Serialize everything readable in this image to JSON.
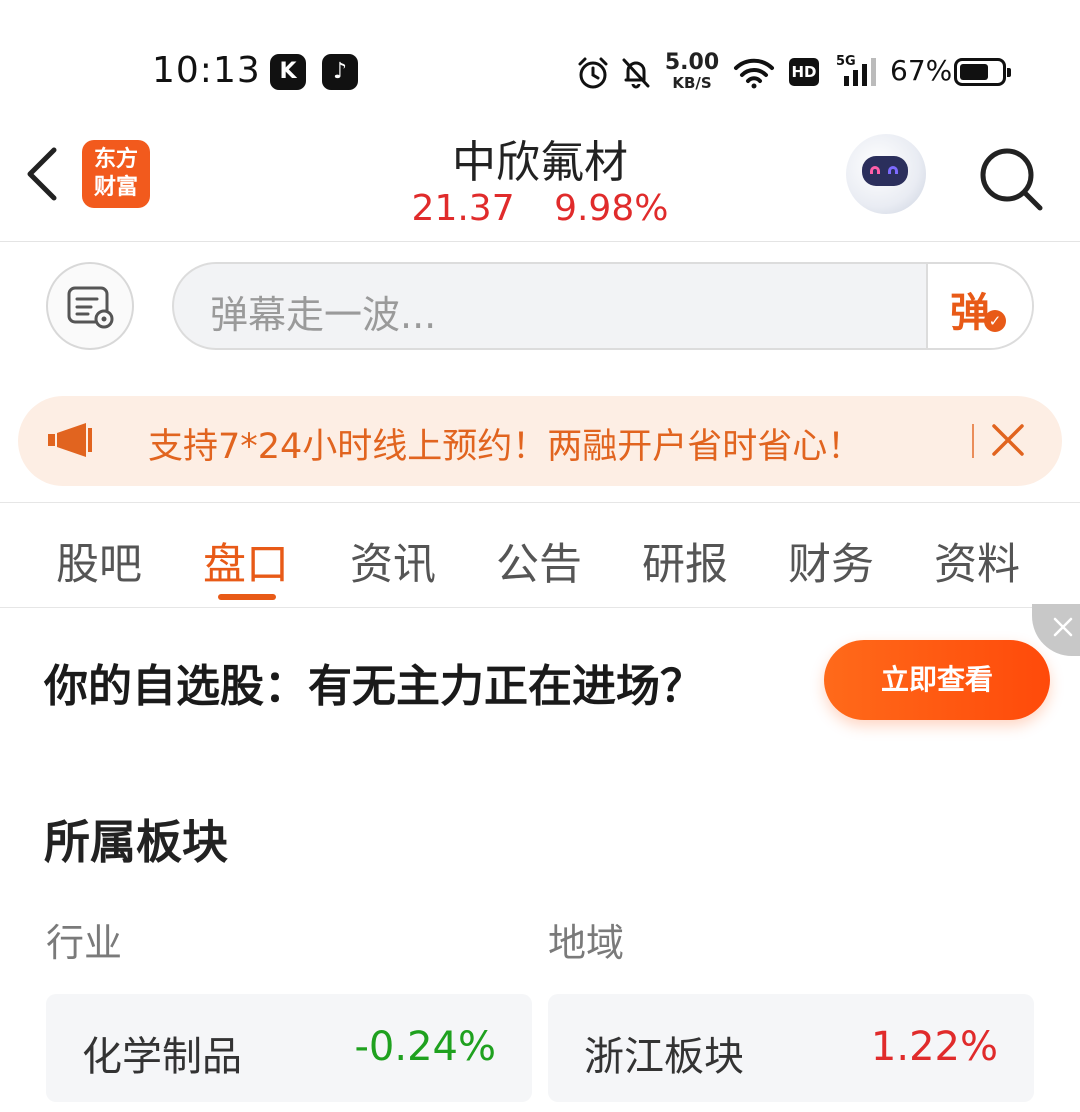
{
  "status_bar": {
    "time": "10:13",
    "apps": [
      {
        "icon": "kuaishou-app-icon",
        "glyph": "K"
      },
      {
        "icon": "tiktok-app-icon",
        "glyph": "♪"
      }
    ],
    "net_speed_value": "5.00",
    "net_speed_unit": "KB/S",
    "hd_label": "HD",
    "network_label": "5G",
    "battery_percent": "67%",
    "battery_level": 0.67
  },
  "header": {
    "brand_logo_text": "东方\n财富",
    "stock_name": "中欣氟材",
    "price": "21.37",
    "change_percent": "9.98%",
    "quote_color": "#e02b2b"
  },
  "danmaku": {
    "placeholder": "弹幕走一波...",
    "send_label": "弹",
    "send_badge": "✓"
  },
  "promo": {
    "text": "支持7*24小时线上预约！两融开户省时省心！",
    "color": "#e1641f"
  },
  "tabs": [
    {
      "label": "股吧",
      "active": false
    },
    {
      "label": "盘口",
      "active": true
    },
    {
      "label": "资讯",
      "active": false
    },
    {
      "label": "公告",
      "active": false
    },
    {
      "label": "研报",
      "active": false
    },
    {
      "label": "财务",
      "active": false
    },
    {
      "label": "资料",
      "active": false
    }
  ],
  "ad": {
    "title": "你的自选股：有无主力正在进场？",
    "button_label": "立即查看"
  },
  "sectors": {
    "title": "所属板块",
    "industry_label": "行业",
    "region_label": "地域",
    "industry": {
      "name": "化学制品",
      "change": "-0.24%",
      "color": "#1fa11f"
    },
    "region": {
      "name": "浙江板块",
      "change": "1.22%",
      "color": "#e02b2b"
    }
  }
}
